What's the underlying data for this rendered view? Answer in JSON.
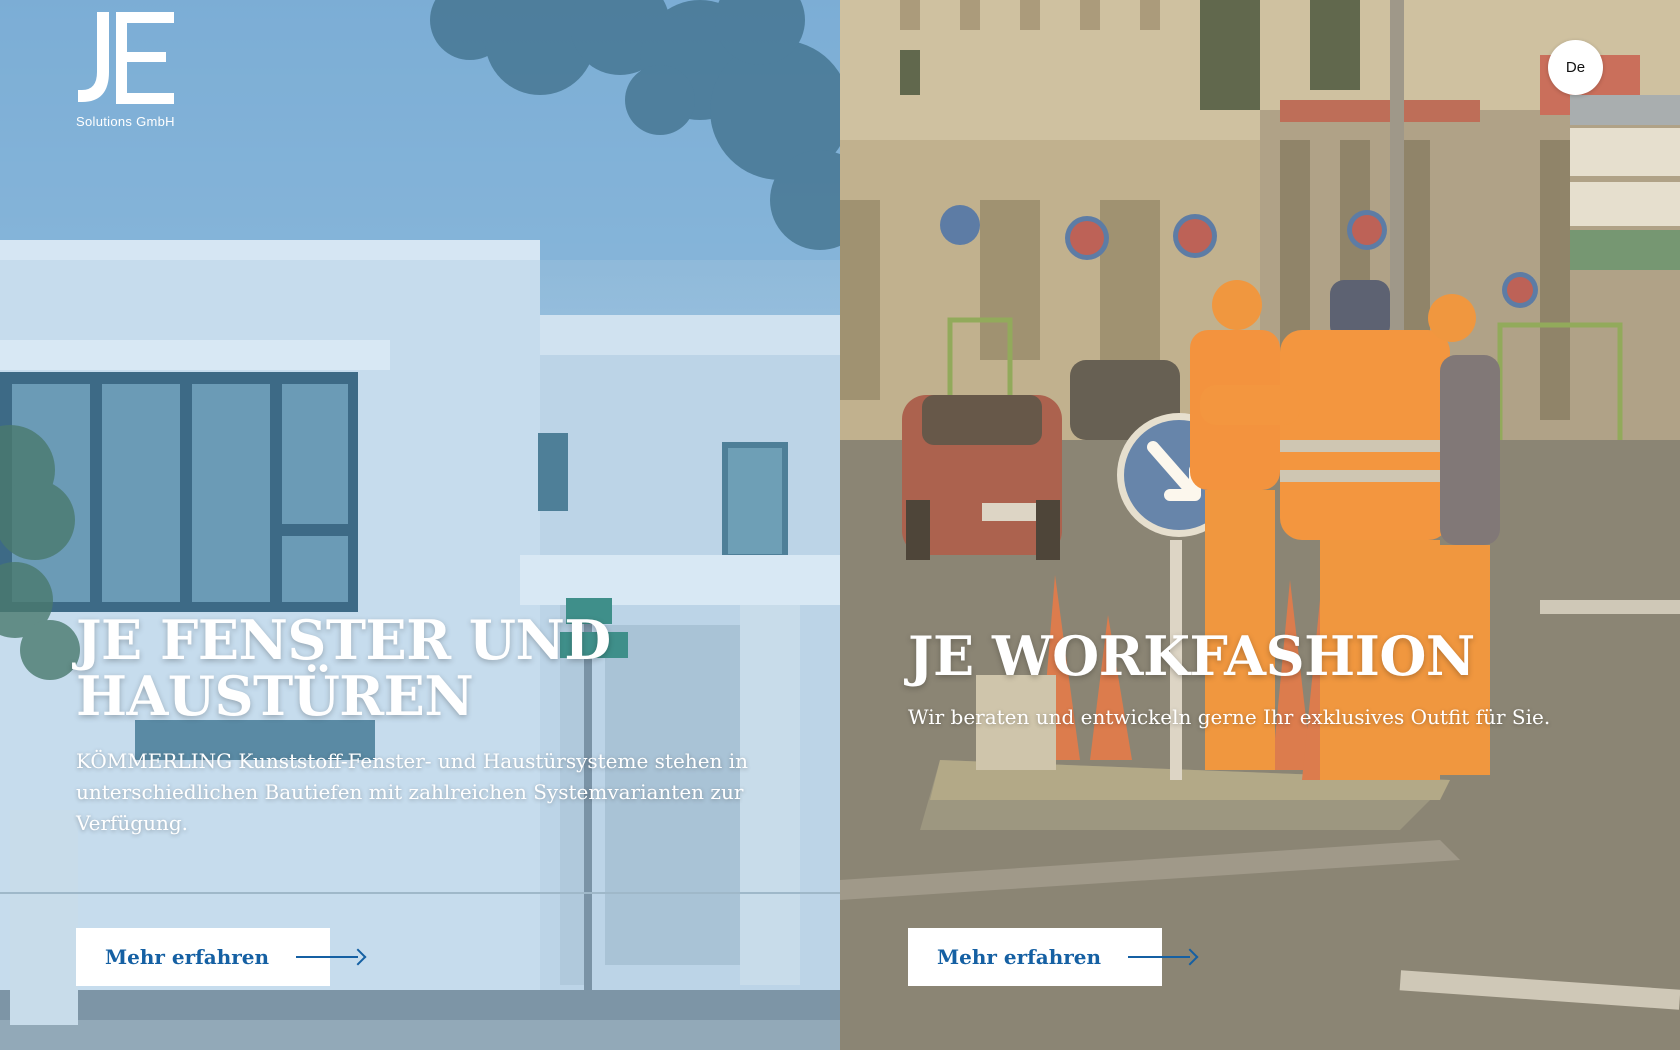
{
  "brand": {
    "company": "Solutions GmbH",
    "logo_monogram": "JE"
  },
  "language": {
    "current": "De"
  },
  "panels": [
    {
      "title_line1": "JE FENSTER UND",
      "title_line2": "HAUSTÜREN",
      "description": "KÖMMERLING Kunststoff-Fenster- und Haustürsysteme stehen in unterschiedlichen Bautiefen mit zahlreichen Systemvarianten zur Verfügung.",
      "cta_label": "Mehr erfahren",
      "overlay_color": "#6fa3d0"
    },
    {
      "title_line1": "JE WORKFASHION",
      "description": "Wir beraten und entwickeln gerne Ihr exklusives Outfit für Sie.",
      "cta_label": "Mehr erfahren",
      "overlay_color": "#d9c49a"
    }
  ],
  "colors": {
    "accent": "#1560a3",
    "button_bg": "#ffffff",
    "text_light": "#ffffff"
  },
  "icons": {
    "cta_arrow": "arrow-right-icon"
  }
}
